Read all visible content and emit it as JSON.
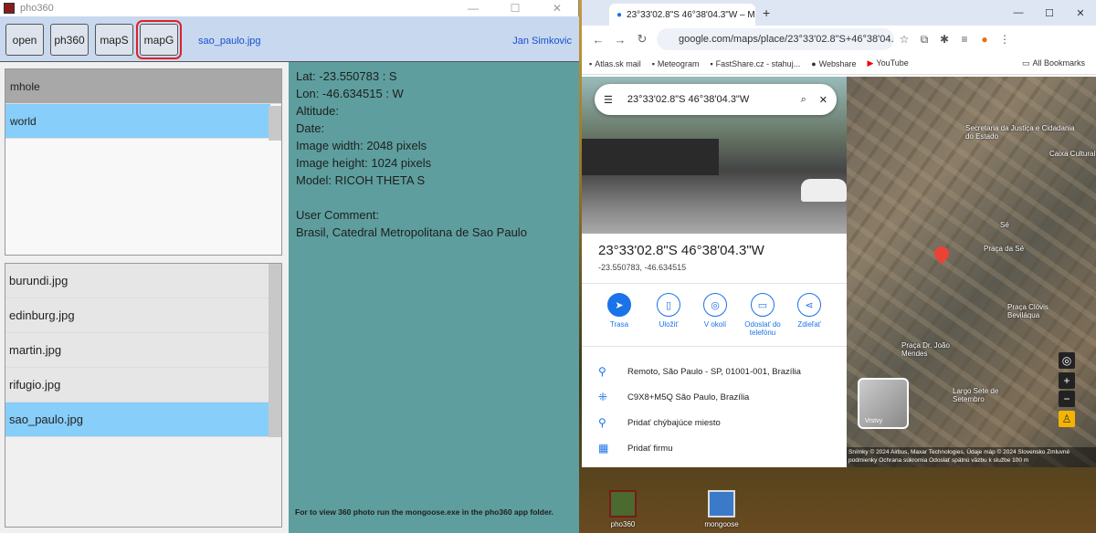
{
  "app": {
    "title": "pho360",
    "toolbar": {
      "open": "open",
      "ph360": "ph360",
      "mapS": "mapS",
      "mapG": "mapG",
      "filename": "sao_paulo.jpg",
      "author": "Jan Simkovic"
    },
    "folders": [
      {
        "label": "mhole",
        "state": "header"
      },
      {
        "label": "world",
        "state": "selected"
      }
    ],
    "files": [
      {
        "label": "burundi.jpg"
      },
      {
        "label": "edinburg.jpg"
      },
      {
        "label": "martin.jpg"
      },
      {
        "label": "rifugio.jpg"
      },
      {
        "label": "sao_paulo.jpg"
      }
    ],
    "info": {
      "lat": "Lat: -23.550783 : S",
      "lon": "Lon: -46.634515 : W",
      "altitude": "Altitude:",
      "date": "Date:",
      "width": "Image width:  2048 pixels",
      "height": "Image height:  1024 pixels",
      "model": "Model:  RICOH THETA S",
      "comment_label": "User Comment:",
      "comment": " Brasil, Catedral Metropolitana de Sao Paulo",
      "hint": "For to view 360 photo run the mongoose.exe in the pho360 app folder."
    }
  },
  "browser": {
    "tab_title": "23°33'02.8\"S 46°38'04.3\"W – M…",
    "url": "google.com/maps/place/23°33'02.8\"S+46°38'04.3\"W/...",
    "bookmarks": [
      "Atlas.sk mail",
      "Meteogram",
      "FastShare.cz - stahuj...",
      "Webshare",
      "YouTube"
    ],
    "all_bookmarks": "All Bookmarks",
    "search_query": "23°33'02.8\"S 46°38'04.3\"W",
    "place_title": "23°33'02.8\"S 46°38'04.3\"W",
    "place_coords": "-23.550783, -46.634515",
    "actions": [
      "Trasa",
      "Uložiť",
      "V okolí",
      "Odoslať do telefónu",
      "Zdieľať"
    ],
    "details": [
      "Remoto, São Paulo - SP, 01001-001, Brazília",
      "C9X8+M5Q São Paulo, Brazília",
      "Pridať chýbajúce miesto",
      "Pridať firmu"
    ],
    "map_labels": [
      "Secretaria da Justiça e Cidadania do Estado",
      "Praça da Sé",
      "Praça Clóvis Beviláqua",
      "Praça Dr. João Mendes",
      "Largo Sete de Setembro",
      "Caixa Cultural",
      "Sé"
    ],
    "layers_label": "Vrstvy",
    "attribution": "Snímky © 2024 Airbus, Maxar Technologies, Údaje máp © 2024   Slovensko   Zmluvné podmienky   Ochrana súkromia   Odoslať spätnú väzbu k službe   100 m"
  },
  "desktop": {
    "icons": [
      "pho360",
      "mongoose"
    ]
  }
}
